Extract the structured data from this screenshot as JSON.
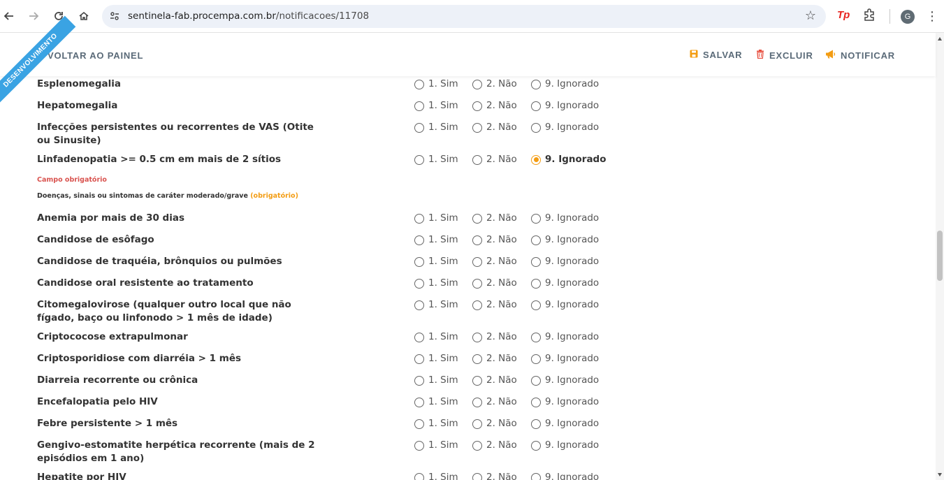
{
  "browser": {
    "url_domain": "sentinela-fab.procempa.com.br",
    "url_path": "/notificacoes/11708",
    "extension_label": "Tp",
    "avatar_letter": "G"
  },
  "toolbar": {
    "ribbon": "DESENVOLVIMENTO",
    "back_label": "VOLTAR AO PAINEL",
    "save_label": "SALVAR",
    "delete_label": "EXCLUIR",
    "notify_label": "NOTIFICAR",
    "colors": {
      "save_icon": "#f39c12",
      "delete_icon": "#e74c3c",
      "notify_icon": "#f39c12"
    }
  },
  "options": [
    "1. Sim",
    "2. Não",
    "9. Ignorado"
  ],
  "group1": [
    {
      "label": "Esplenomegalia",
      "selected": null
    },
    {
      "label": "Hepatomegalia",
      "selected": null
    },
    {
      "label": "Infecções persistentes ou recorrentes de VAS (Otite ou Sinusite)",
      "selected": null
    },
    {
      "label": "Linfadenopatia >= 0.5 cm em mais de 2 sítios",
      "selected": "9. Ignorado"
    }
  ],
  "required_error": "Campo obrigatório",
  "section2": {
    "title": "Doenças, sinais ou sintomas de caráter moderado/grave",
    "required": "(obrigatório)"
  },
  "group2": [
    {
      "label": "Anemia por mais de 30 dias",
      "selected": null
    },
    {
      "label": "Candidose de esôfago",
      "selected": null
    },
    {
      "label": "Candidose de traquéia, brônquios ou pulmões",
      "selected": null
    },
    {
      "label": "Candidose oral resistente ao tratamento",
      "selected": null
    },
    {
      "label": "Citomegalovirose (qualquer outro local que não fígado, baço ou linfonodo > 1 mês de idade)",
      "selected": null
    },
    {
      "label": "Criptococose extrapulmonar",
      "selected": null
    },
    {
      "label": "Criptosporidiose com diarréia > 1 mês",
      "selected": null
    },
    {
      "label": "Diarreia recorrente ou crônica",
      "selected": null
    },
    {
      "label": "Encefalopatia pelo HIV",
      "selected": null
    },
    {
      "label": "Febre persistente > 1 mês",
      "selected": null
    },
    {
      "label": "Gengivo-estomatite herpética recorrente (mais de 2 episódios em 1 ano)",
      "selected": null
    },
    {
      "label": "Hepatite por HIV",
      "selected": null
    }
  ]
}
